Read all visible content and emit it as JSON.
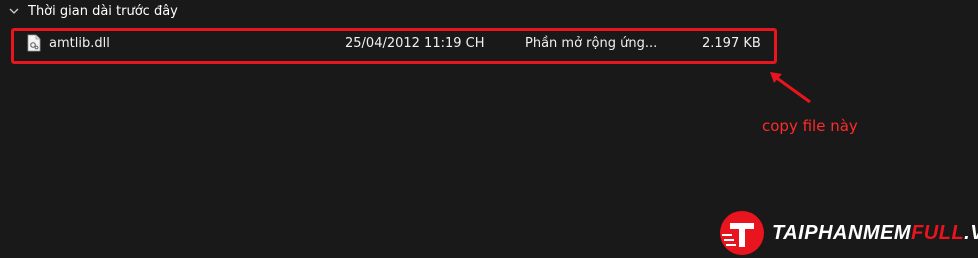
{
  "group": {
    "label": "Thời gian dài trước đây",
    "icon": "chevron-down-icon"
  },
  "file": {
    "icon": "dll-file-icon",
    "name": "amtlib.dll",
    "date": "25/04/2012 11:19 CH",
    "type": "Phần mở rộng ứng...",
    "size": "2.197 KB"
  },
  "annotation": {
    "text": "copy file này",
    "color": "#e8141e"
  },
  "watermark": {
    "prefix": "T",
    "text_main": "AIPHANMEM",
    "text_accent": "FULL",
    "text_suffix": ".VN"
  },
  "colors": {
    "background": "#191919",
    "highlight": "#e8141e"
  }
}
